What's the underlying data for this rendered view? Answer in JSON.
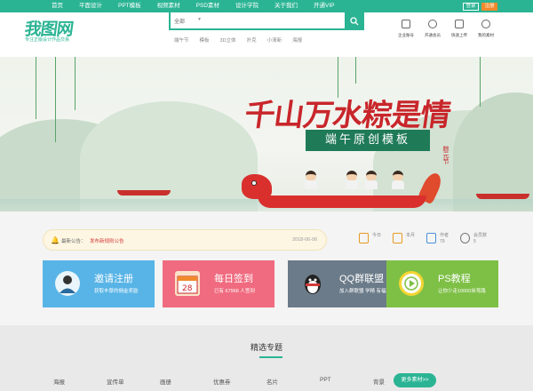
{
  "topnav": {
    "items": [
      "首页",
      "平面设计",
      "PPT模板",
      "视频素材",
      "PSD素材",
      "设计学院",
      "关于我们",
      "开通VIP"
    ],
    "login_label": "登录",
    "register_label": "注册"
  },
  "header": {
    "logo_text": "我图网",
    "slogan": "专注正版设计作品交易",
    "search": {
      "category": "全部",
      "placeholder": "",
      "hot_words": [
        "端午节",
        "模板",
        "3D立体",
        "扑克",
        "小清新",
        "海报"
      ]
    },
    "icons": [
      {
        "label": "企业账号",
        "icon": "building-icon"
      },
      {
        "label": "开通会员",
        "icon": "vip-icon"
      },
      {
        "label": "快速上传",
        "icon": "upload-icon"
      },
      {
        "label": "我的素材",
        "icon": "user-icon"
      }
    ]
  },
  "banner": {
    "title": "千山万水粽是情",
    "subtitle": "端午原创模板",
    "seal": "粽元节"
  },
  "notice": {
    "label": "最新公告：",
    "text": "发布新规则公告",
    "date": "2018-06-06"
  },
  "stats": [
    {
      "label1": "今日",
      "label2": "",
      "icon": "calendar-icon"
    },
    {
      "label1": "本月",
      "label2": "",
      "icon": "calendar-icon"
    },
    {
      "label1": "作者",
      "label2": "79",
      "icon": "document-icon"
    },
    {
      "label1": "会员数",
      "label2": "5",
      "icon": "users-icon"
    }
  ],
  "cards": [
    {
      "title": "邀请注册",
      "desc": "获取丰厚的佣金奖励",
      "color": "#58b4e6",
      "icon": "invite-user-icon"
    },
    {
      "title": "每日签到",
      "desc": "已有 67966 人签到",
      "color": "#f06b7f",
      "icon": "calendar-28-icon"
    },
    {
      "title": "QQ群联盟",
      "desc": "加入群联盟 学精 有福利",
      "color": "#6b7b89",
      "icon": "qq-penguin-icon"
    },
    {
      "title": "PS教程",
      "desc": "让你少走10000米弯路",
      "color": "#7ec046",
      "icon": "play-icon"
    }
  ],
  "featured": {
    "title": "精选专题",
    "categories": [
      "海报",
      "宣传单",
      "画册",
      "优惠券",
      "名片",
      "PPT",
      "背景"
    ],
    "more_label": "更多素材>>"
  },
  "colors": {
    "brand": "#2bb494",
    "accent": "#f08a2b",
    "banner_red": "#c8262b"
  }
}
